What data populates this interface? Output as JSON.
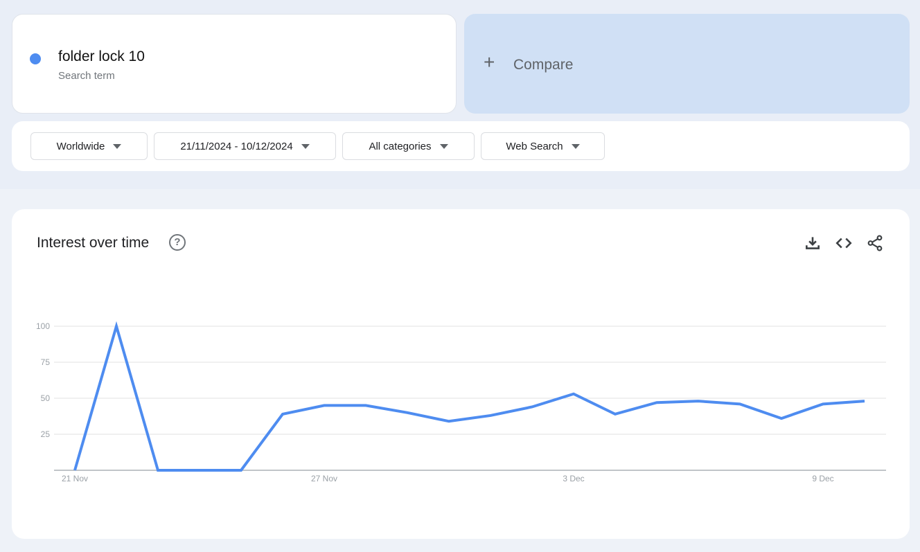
{
  "search_term": {
    "name": "folder lock 10",
    "subtitle": "Search term",
    "color": "#4e8cf0"
  },
  "compare": {
    "icon": "plus-icon",
    "label": "Compare"
  },
  "filters": [
    {
      "label": "Worldwide"
    },
    {
      "label": "21/11/2024 - 10/12/2024"
    },
    {
      "label": "All categories"
    },
    {
      "label": "Web Search"
    }
  ],
  "panel": {
    "title": "Interest over time",
    "help_icon": "help-circle-icon",
    "help_glyph": "?",
    "actions": [
      "download-icon",
      "embed-code-icon",
      "share-icon"
    ]
  },
  "chart_data": {
    "type": "line",
    "title": "Interest over time",
    "xlabel": "",
    "ylabel": "",
    "ylim": [
      0,
      100
    ],
    "yticks": [
      25,
      50,
      75,
      100
    ],
    "grid": true,
    "line_color": "#4e8cf0",
    "x": [
      "21 Nov",
      "22 Nov",
      "23 Nov",
      "24 Nov",
      "25 Nov",
      "26 Nov",
      "27 Nov",
      "28 Nov",
      "29 Nov",
      "30 Nov",
      "1 Dec",
      "2 Dec",
      "3 Dec",
      "4 Dec",
      "5 Dec",
      "6 Dec",
      "7 Dec",
      "8 Dec",
      "9 Dec",
      "10 Dec"
    ],
    "xtick_labels": [
      {
        "index": 0,
        "label": "21 Nov"
      },
      {
        "index": 6,
        "label": "27 Nov"
      },
      {
        "index": 12,
        "label": "3 Dec"
      },
      {
        "index": 18,
        "label": "9 Dec"
      }
    ],
    "series": [
      {
        "name": "folder lock 10",
        "values": [
          0,
          100,
          0,
          0,
          0,
          39,
          45,
          45,
          40,
          34,
          38,
          44,
          53,
          39,
          47,
          48,
          46,
          36,
          46,
          48
        ]
      }
    ]
  }
}
